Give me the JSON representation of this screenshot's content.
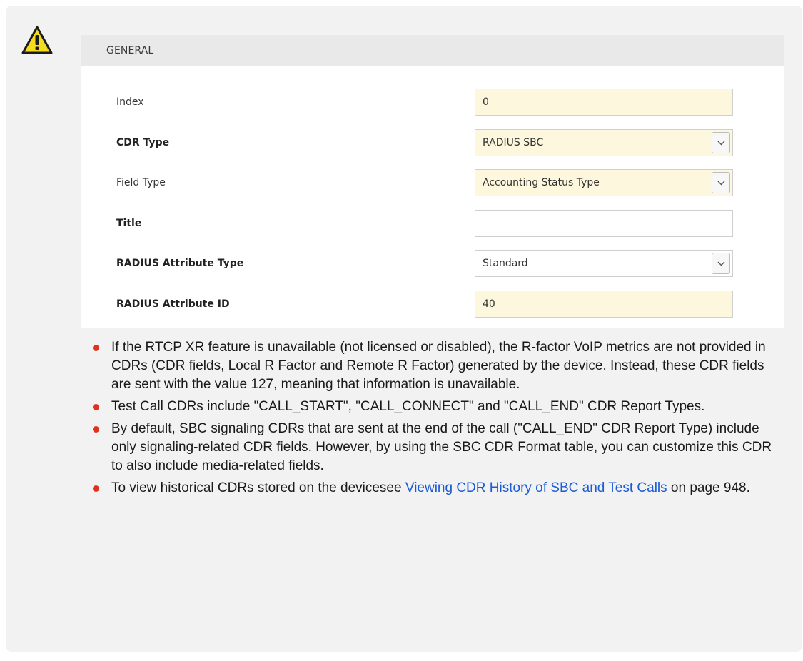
{
  "panel": {
    "header": "GENERAL",
    "fields": [
      {
        "label": "Index",
        "value": "0",
        "bold": false,
        "kind": "input",
        "filled": true
      },
      {
        "label": "CDR Type",
        "value": "RADIUS SBC",
        "bold": true,
        "kind": "select",
        "filled": true
      },
      {
        "label": "Field Type",
        "value": "Accounting Status Type",
        "bold": false,
        "kind": "select",
        "filled": true
      },
      {
        "label": "Title",
        "value": "",
        "bold": true,
        "kind": "input",
        "filled": false
      },
      {
        "label": "RADIUS Attribute Type",
        "value": "Standard",
        "bold": true,
        "kind": "select",
        "filled": false
      },
      {
        "label": "RADIUS Attribute ID",
        "value": "40",
        "bold": true,
        "kind": "input",
        "filled": true
      }
    ]
  },
  "notes": {
    "bullet_color": "#e0301e",
    "items": [
      {
        "text": "If the RTCP XR feature is unavailable (not licensed or disabled), the R-factor VoIP metrics are not provided in CDRs (CDR fields, Local R Factor and Remote R Factor) generated by the device. Instead, these CDR fields are sent with the value 127, meaning that information is unavailable."
      },
      {
        "text": "Test Call CDRs include \"CALL_START\", \"CALL_CONNECT\" and \"CALL_END\" CDR Report Types."
      },
      {
        "text": "By default, SBC signaling CDRs that are sent at the end of the call (\"CALL_END\" CDR Report Type) include only signaling-related CDR fields. However, by using the SBC CDR Format table, you can customize this CDR to also include media-related fields."
      },
      {
        "text": "To view historical CDRs stored on the devicesee ",
        "link": "Viewing CDR History of SBC and Test Calls",
        "after": " on page 948."
      }
    ]
  },
  "icons": {
    "warning": "warning-triangle-icon",
    "dropdown": "chevron-down-icon"
  },
  "colors": {
    "note_background": "#f2f2f2",
    "header_background": "#e9e9e9",
    "field_fill": "#fdf8dd",
    "link": "#1a5bd6"
  }
}
